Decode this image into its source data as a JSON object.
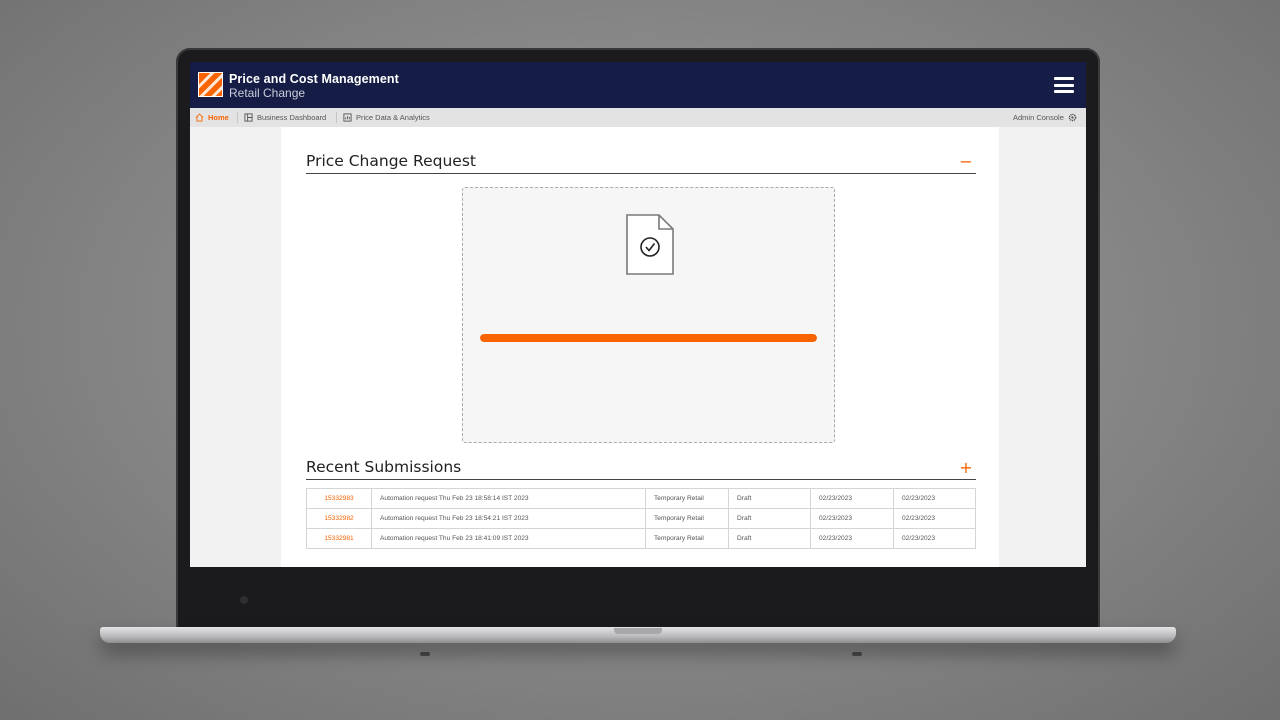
{
  "header": {
    "app_title": "Price and Cost Management",
    "app_subtitle": "Retail Change"
  },
  "nav": {
    "home": "Home",
    "business_dashboard": "Business Dashboard",
    "price_data": "Price Data & Analytics",
    "admin_console": "Admin Console"
  },
  "price_change": {
    "title": "Price Change Request",
    "toggle": "−",
    "upload_progress": 1.0
  },
  "recent": {
    "title": "Recent Submissions",
    "toggle": "+",
    "rows": [
      {
        "id": "15332983",
        "description": "Automation request Thu Feb 23 18:58:14 IST 2023",
        "type": "Temporary Retail",
        "status": "Draft",
        "date1": "02/23/2023",
        "date2": "02/23/2023"
      },
      {
        "id": "15332982",
        "description": "Automation request Thu Feb 23 18:54:21 IST 2023",
        "type": "Temporary Retail",
        "status": "Draft",
        "date1": "02/23/2023",
        "date2": "02/23/2023"
      },
      {
        "id": "15332981",
        "description": "Automation request Thu Feb 23 18:41:09 IST 2023",
        "type": "Temporary Retail",
        "status": "Draft",
        "date1": "02/23/2023",
        "date2": "02/23/2023"
      }
    ]
  },
  "colors": {
    "brand_orange": "#f96302",
    "header_navy": "#151d46"
  }
}
